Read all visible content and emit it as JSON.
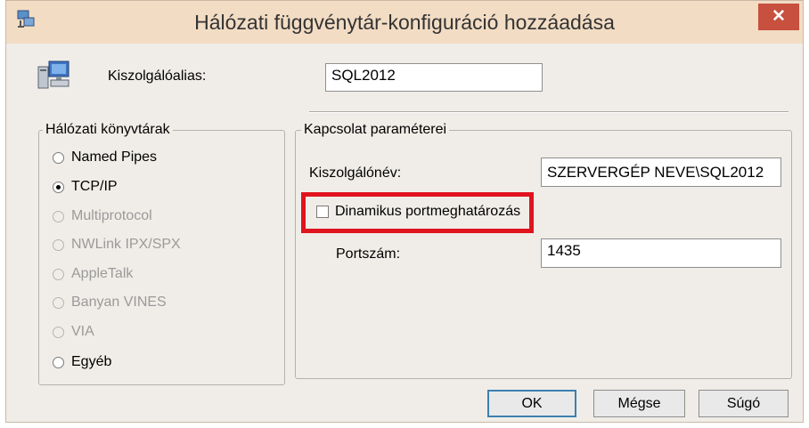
{
  "window": {
    "title": "Hálózati függvénytár-konfiguráció hozzáadása",
    "close_symbol": "✕"
  },
  "alias": {
    "label": "Kiszolgálóalias:",
    "value": "SQL2012"
  },
  "libraries": {
    "title": "Hálózati könyvtárak",
    "options": [
      {
        "label": "Named Pipes",
        "enabled": true,
        "selected": false
      },
      {
        "label": "TCP/IP",
        "enabled": true,
        "selected": true
      },
      {
        "label": "Multiprotocol",
        "enabled": false,
        "selected": false
      },
      {
        "label": "NWLink IPX/SPX",
        "enabled": false,
        "selected": false
      },
      {
        "label": "AppleTalk",
        "enabled": false,
        "selected": false
      },
      {
        "label": "Banyan VINES",
        "enabled": false,
        "selected": false
      },
      {
        "label": "VIA",
        "enabled": false,
        "selected": false
      },
      {
        "label": "Egyéb",
        "enabled": true,
        "selected": false
      }
    ]
  },
  "connection": {
    "title": "Kapcsolat paraméterei",
    "server_label": "Kiszolgálónév:",
    "server_value": "SZERVERGÉP NEVE\\SQL2012",
    "dynamic_port_label": "Dinamikus portmeghatározás",
    "dynamic_port_checked": false,
    "port_label": "Portszám:",
    "port_value": "1435"
  },
  "buttons": {
    "ok": "OK",
    "cancel": "Mégse",
    "help": "Súgó"
  },
  "colors": {
    "highlight": "#e0141f",
    "close": "#c7503f",
    "titlebar": "#f2dcc4"
  }
}
